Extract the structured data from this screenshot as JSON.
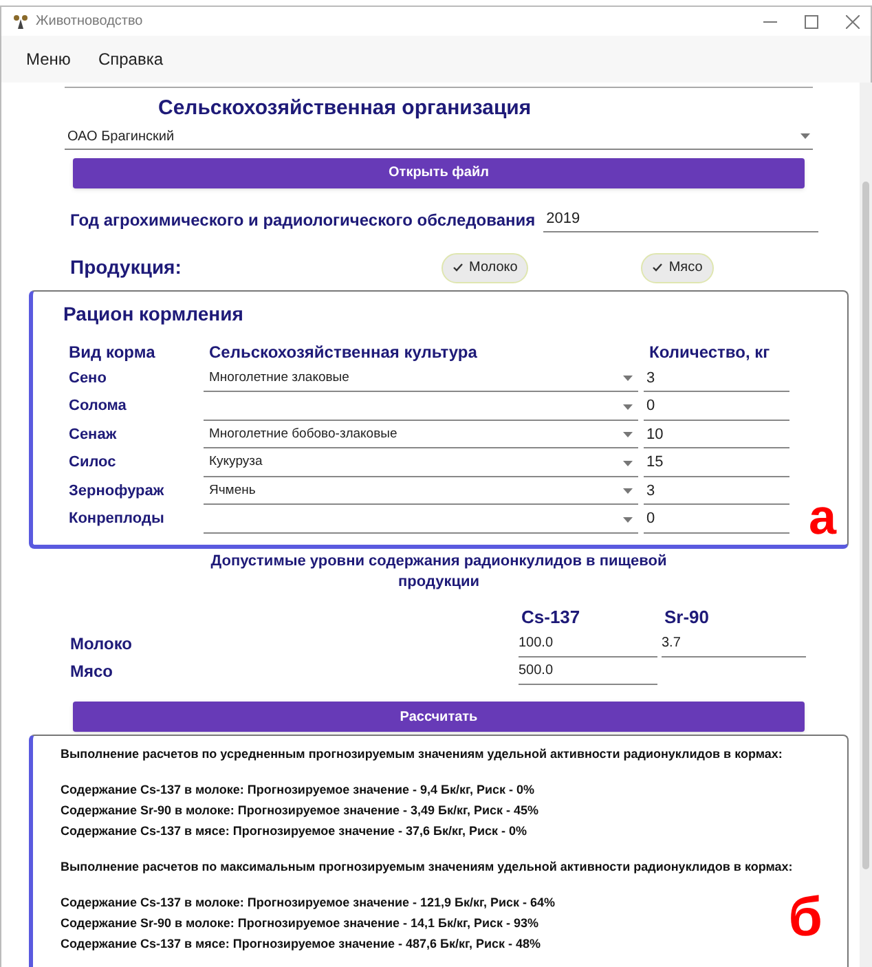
{
  "window": {
    "title": "Животноводство"
  },
  "menu": [
    "Меню",
    "Справка"
  ],
  "organization": {
    "label": "Сельскохозяйственная организация",
    "value": "ОАО Брагинский"
  },
  "open_button": "Открыть файл",
  "survey_year": {
    "label": "Год агрохимического и радиологического обследования",
    "value": "2019"
  },
  "products": {
    "label": "Продукция:",
    "chips": [
      {
        "label": "Молоко",
        "selected": true
      },
      {
        "label": "Мясо",
        "selected": true
      }
    ]
  },
  "ration": {
    "title": "Рацион кормления",
    "columns": [
      "Вид корма",
      "Сельскохозяйственная культура",
      "Количество, кг"
    ],
    "rows": [
      {
        "feed": "Сено",
        "crop": "Многолетние злаковые",
        "amount": "3"
      },
      {
        "feed": "Солома",
        "amount": "0"
      },
      {
        "feed": "Сенаж",
        "crop": "Многолетние бобово-злаковые",
        "amount": "10"
      },
      {
        "feed": "Силос",
        "crop": "Кукуруза",
        "amount": "15"
      },
      {
        "feed": "Зернофураж",
        "crop": "Ячмень",
        "amount": "3"
      },
      {
        "feed": "Конреплоды",
        "amount": "0"
      }
    ],
    "annotation": "а"
  },
  "limits": {
    "title": "Допустимые уровни содержания радионкулидов в пищевой продукции",
    "columns": [
      "Cs-137",
      "Sr-90"
    ],
    "rows": [
      {
        "label": "Молоко",
        "values": [
          "100.0",
          "3.7"
        ]
      },
      {
        "label": "Мясо",
        "values": [
          "500.0"
        ]
      }
    ]
  },
  "calculate_button": "Рассчитать",
  "results": {
    "annotation": "б",
    "lines": [
      {
        "kind": "heading",
        "text": "Выполнение расчетов по усредненным прогнозируемым значениям удельной активности радионуклидов в кормах:"
      },
      {
        "kind": "line",
        "text": "Содержание Cs-137 в молоке: Прогнозируемое значение - 9,4 Бк/кг, Риск - 0%"
      },
      {
        "kind": "line",
        "text": "Содержание Sr-90 в молоке: Прогнозируемое значение - 3,49 Бк/кг, Риск - 45%"
      },
      {
        "kind": "line",
        "text": "Содержание Cs-137 в мясе: Прогнозируемое значение - 37,6 Бк/кг, Риск - 0%"
      },
      {
        "kind": "heading",
        "text": "Выполнение расчетов по максимальным прогнозируемым значениям удельной активности радионуклидов в кормах:"
      },
      {
        "kind": "line",
        "text": "Содержание Cs-137 в молоке: Прогнозируемое значение - 121,9 Бк/кг, Риск - 64%"
      },
      {
        "kind": "line",
        "text": "Содержание Sr-90 в молоке: Прогнозируемое значение - 14,1 Бк/кг, Риск - 93%"
      },
      {
        "kind": "line",
        "text": "Содержание Cs-137 в мясе: Прогнозируемое значение - 487,6 Бк/кг, Риск - 48%"
      }
    ]
  }
}
